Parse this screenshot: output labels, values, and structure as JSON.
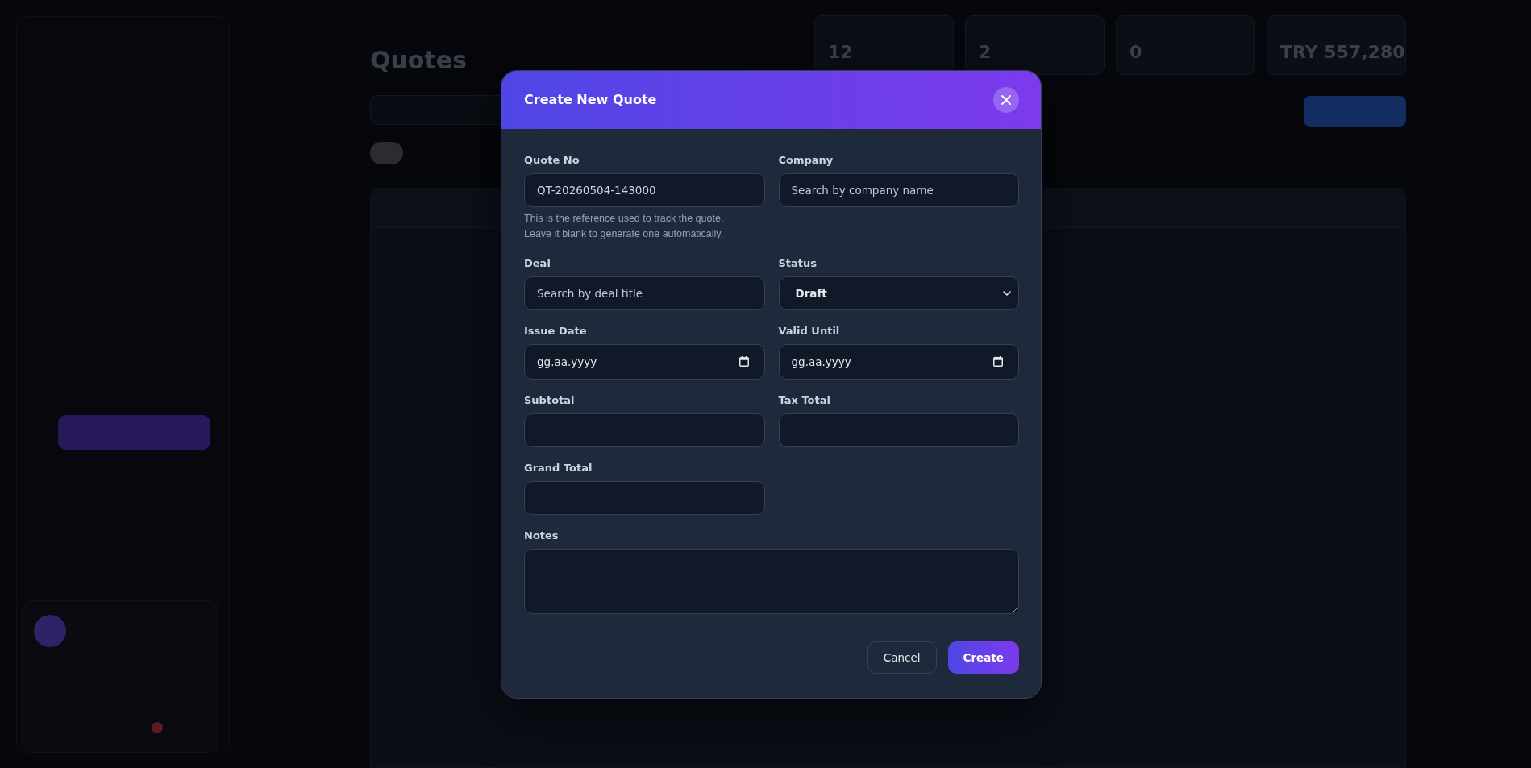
{
  "page": {
    "title": "Quotes",
    "stat_values": [
      "12",
      "2",
      "0",
      "TRY 557,280"
    ]
  },
  "modal": {
    "title": "Create New Quote",
    "fields": [
      {
        "kind": "text",
        "label": "Quote No",
        "value": "QT-20260504-143000",
        "help": "This is the reference used to track the quote. Leave it blank to generate one automatically."
      },
      {
        "kind": "text",
        "label": "Company",
        "placeholder": "Search by company name"
      },
      {
        "kind": "text",
        "label": "Deal",
        "placeholder": "Search by deal title"
      },
      {
        "kind": "select",
        "label": "Status",
        "value": "Draft"
      },
      {
        "kind": "date",
        "label": "Issue Date",
        "placeholder": "gg.aa.yyyy"
      },
      {
        "kind": "date",
        "label": "Valid Until",
        "placeholder": "gg.aa.yyyy"
      },
      {
        "kind": "text",
        "label": "Subtotal"
      },
      {
        "kind": "text",
        "label": "Tax Total"
      },
      {
        "kind": "text",
        "label": "Grand Total"
      },
      {
        "kind": "textarea",
        "label": "Notes"
      }
    ],
    "buttons": [
      {
        "kind": "secondary",
        "label": "Cancel"
      },
      {
        "kind": "primary",
        "label": "Create"
      }
    ]
  }
}
